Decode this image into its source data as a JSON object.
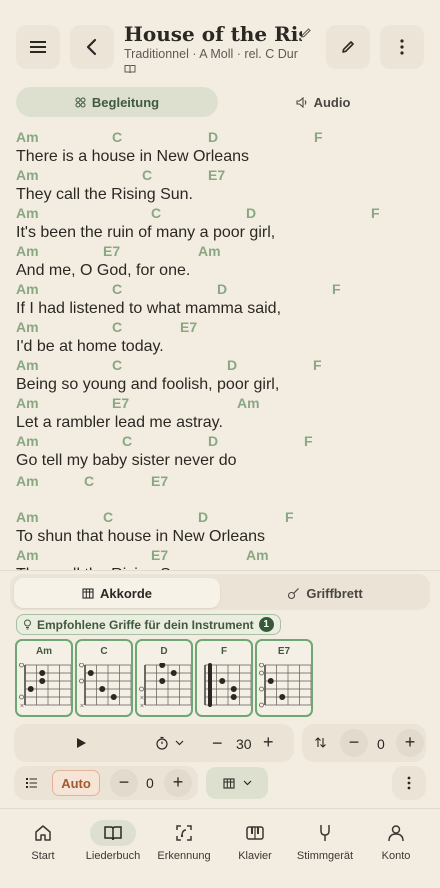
{
  "header": {
    "title": "House of the Risi...",
    "subtitle": "Traditionnel  ·  A Moll  ·  rel. C Dur"
  },
  "mode_tabs": {
    "accompaniment": "Begleitung",
    "audio": "Audio"
  },
  "song": [
    {
      "chords": [
        {
          "name": "Am",
          "col": 16
        },
        {
          "name": "C",
          "col": 112
        },
        {
          "name": "D",
          "col": 208
        },
        {
          "name": "F",
          "col": 314
        }
      ],
      "lyric": "There is a house in New Orleans"
    },
    {
      "chords": [
        {
          "name": "Am",
          "col": 16
        },
        {
          "name": "C",
          "col": 142
        },
        {
          "name": "E7",
          "col": 208
        }
      ],
      "lyric": "They call the Rising Sun."
    },
    {
      "chords": [
        {
          "name": "Am",
          "col": 16
        },
        {
          "name": "C",
          "col": 151
        },
        {
          "name": "D",
          "col": 246
        },
        {
          "name": "F",
          "col": 371
        }
      ],
      "lyric": "It's been the ruin of many a poor girl,"
    },
    {
      "chords": [
        {
          "name": "Am",
          "col": 16
        },
        {
          "name": "E7",
          "col": 103
        },
        {
          "name": "Am",
          "col": 198
        }
      ],
      "lyric": "And me, O God, for one."
    },
    {
      "chords": [
        {
          "name": "Am",
          "col": 16
        },
        {
          "name": "C",
          "col": 112
        },
        {
          "name": "D",
          "col": 217
        },
        {
          "name": "F",
          "col": 332
        }
      ],
      "lyric": "If I had listened to what mamma said,"
    },
    {
      "chords": [
        {
          "name": "Am",
          "col": 16
        },
        {
          "name": "C",
          "col": 112
        },
        {
          "name": "E7",
          "col": 180
        }
      ],
      "lyric": "I'd be at home today."
    },
    {
      "chords": [
        {
          "name": "Am",
          "col": 16
        },
        {
          "name": "C",
          "col": 112
        },
        {
          "name": "D",
          "col": 227
        },
        {
          "name": "F",
          "col": 313
        }
      ],
      "lyric": "Being so young and foolish, poor girl,"
    },
    {
      "chords": [
        {
          "name": "Am",
          "col": 16
        },
        {
          "name": "E7",
          "col": 112
        },
        {
          "name": "Am",
          "col": 237
        }
      ],
      "lyric": "Let a rambler lead me astray."
    },
    {
      "chords": [
        {
          "name": "Am",
          "col": 16
        },
        {
          "name": "C",
          "col": 122
        },
        {
          "name": "D",
          "col": 208
        },
        {
          "name": "F",
          "col": 304
        }
      ],
      "lyric": "Go tell my baby sister never do"
    },
    {
      "chords": [
        {
          "name": "Am",
          "col": 16
        },
        {
          "name": "C",
          "col": 84
        },
        {
          "name": "E7",
          "col": 151
        }
      ],
      "lyric": ""
    },
    {
      "chords": [
        {
          "name": "Am",
          "col": 16
        },
        {
          "name": "C",
          "col": 103
        },
        {
          "name": "D",
          "col": 198
        },
        {
          "name": "F",
          "col": 285
        }
      ],
      "lyric": "To shun that house in New Orleans"
    },
    {
      "chords": [
        {
          "name": "Am",
          "col": 16
        },
        {
          "name": "E7",
          "col": 151
        },
        {
          "name": "Am",
          "col": 246
        }
      ],
      "lyric": "They call the Rising Sun."
    }
  ],
  "panel_tabs": {
    "chords": "Akkorde",
    "fretboard": "Griffbrett"
  },
  "recommendation": {
    "text": "Empfohlene Griffe für dein Instrument",
    "count": "1"
  },
  "chord_cards": [
    {
      "name": "Am",
      "dots": [
        [
          2,
          2
        ],
        [
          3,
          2
        ],
        [
          4,
          1
        ]
      ],
      "open": [
        1,
        5
      ],
      "mute": [
        6
      ],
      "barre": false
    },
    {
      "name": "C",
      "dots": [
        [
          2,
          1
        ],
        [
          4,
          2
        ],
        [
          5,
          3
        ]
      ],
      "open": [
        1,
        3
      ],
      "mute": [
        6
      ],
      "barre": false
    },
    {
      "name": "D",
      "dots": [
        [
          1,
          2
        ],
        [
          2,
          3
        ],
        [
          3,
          2
        ]
      ],
      "open": [
        4
      ],
      "mute": [
        5,
        6
      ],
      "barre": false
    },
    {
      "name": "F",
      "dots": [
        [
          3,
          2
        ],
        [
          4,
          3
        ],
        [
          5,
          3
        ]
      ],
      "open": [],
      "mute": [],
      "barre": true
    },
    {
      "name": "E7",
      "dots": [
        [
          3,
          1
        ],
        [
          5,
          2
        ]
      ],
      "open": [
        1,
        2,
        4,
        6
      ],
      "mute": [],
      "barre": false
    }
  ],
  "controls": {
    "tempo_value": "30",
    "transpose_value": "0",
    "auto_label": "Auto",
    "capo_value": "0"
  },
  "nav": [
    {
      "label": "Start",
      "icon": "home-icon"
    },
    {
      "label": "Liederbuch",
      "icon": "book-icon"
    },
    {
      "label": "Erkennung",
      "icon": "recognize-icon"
    },
    {
      "label": "Klavier",
      "icon": "piano-icon"
    },
    {
      "label": "Stimmgerät",
      "icon": "tuning-fork-icon"
    },
    {
      "label": "Konto",
      "icon": "user-icon"
    }
  ],
  "colors": {
    "background": "#f3ede1",
    "chord": "#8aa783",
    "accent_green": "#3f5a3e",
    "auto_orange": "#a25a30"
  }
}
